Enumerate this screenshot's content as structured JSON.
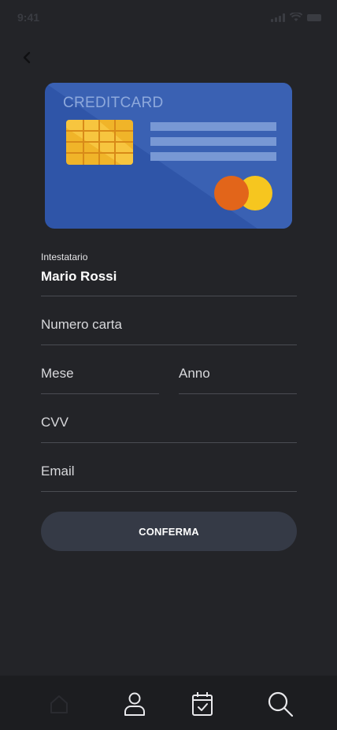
{
  "status_bar": {
    "time": "9:41",
    "icons": [
      "cellular-signal-icon",
      "wifi-icon",
      "battery-icon"
    ]
  },
  "navigation": {
    "back_icon": "chevron-left-icon"
  },
  "card": {
    "title": "CREDITCARD",
    "colors": {
      "body": "#2f55a8",
      "chip": "#f0b429",
      "stripes": "#7898d4",
      "brand_left": "#e2651a",
      "brand_right": "#f6c61f"
    }
  },
  "form": {
    "holder_label": "Intestatario",
    "holder_value": "Mario Rossi",
    "card_number_placeholder": "Numero carta",
    "month_placeholder": "Mese",
    "year_placeholder": "Anno",
    "cvv_placeholder": "CVV",
    "email_placeholder": "Email"
  },
  "actions": {
    "confirm_label": "CONFERMA"
  },
  "tab_bar": {
    "items": [
      "home-icon",
      "profile-icon",
      "calendar-check-icon",
      "search-icon"
    ]
  },
  "colors": {
    "background": "#232428",
    "button": "#353a46",
    "tab_bar": "#1c1d20",
    "divider": "#4a4c52"
  }
}
